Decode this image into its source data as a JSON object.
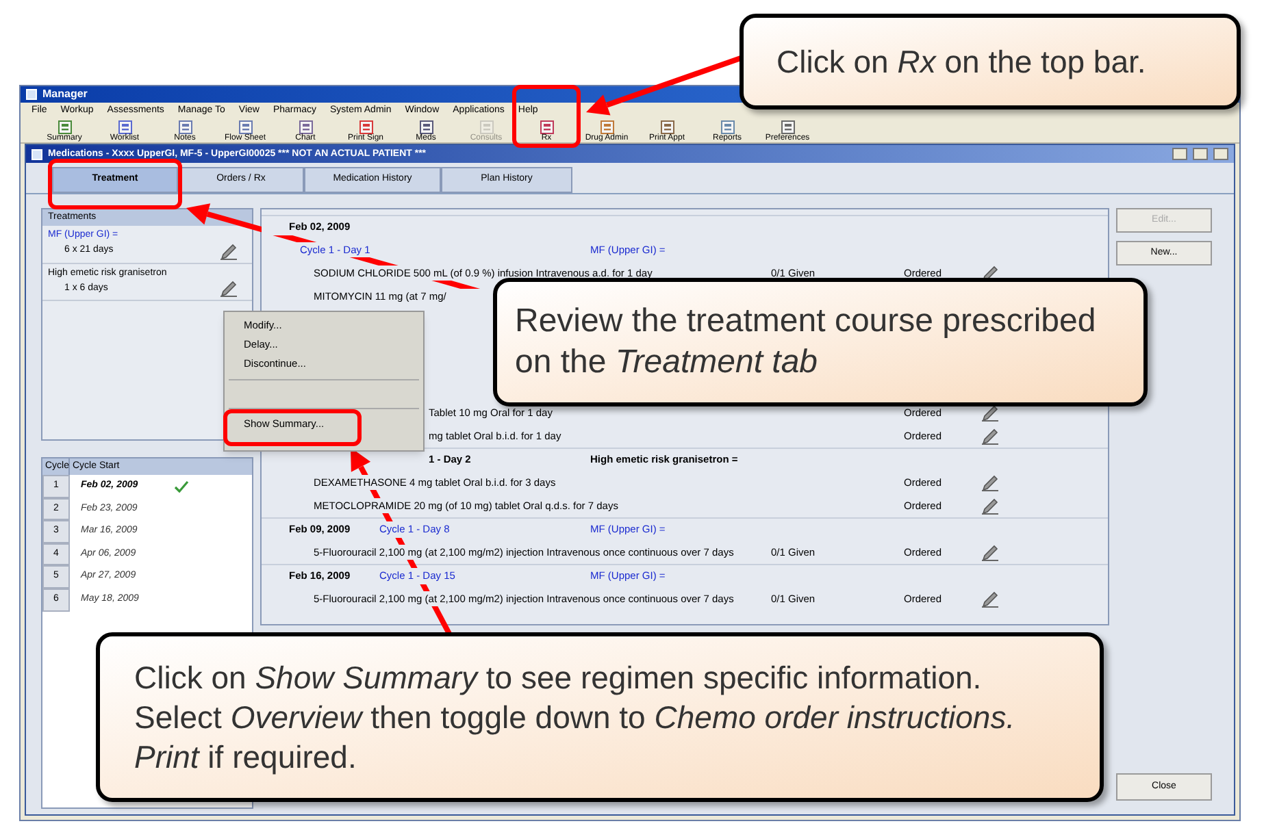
{
  "app_window": {
    "title": "Manager"
  },
  "menu": [
    "File",
    "Workup",
    "Assessments",
    "Manage To",
    "View",
    "Pharmacy",
    "System Admin",
    "Window",
    "Applications",
    "Help"
  ],
  "toolbar": [
    {
      "label": "Summary",
      "disabled": false
    },
    {
      "label": "Worklist",
      "disabled": false
    },
    {
      "label": "Notes",
      "disabled": false
    },
    {
      "label": "Flow Sheet",
      "disabled": false
    },
    {
      "label": "Chart",
      "disabled": false
    },
    {
      "label": "Print Sign",
      "disabled": false
    },
    {
      "label": "Meds",
      "disabled": false
    },
    {
      "label": "Consults",
      "disabled": true
    },
    {
      "label": "Rx",
      "disabled": false
    },
    {
      "label": "Drug Admin",
      "disabled": false
    },
    {
      "label": "Print Appt",
      "disabled": false
    },
    {
      "label": "Reports",
      "disabled": false
    },
    {
      "label": "Preferences",
      "disabled": false
    }
  ],
  "med_window": {
    "title": "Medications - Xxxx UpperGI, MF-5 - UpperGI00025 *** NOT AN ACTUAL PATIENT ***",
    "tabs": [
      {
        "label": "Treatment",
        "selected": true
      },
      {
        "label": "Orders / Rx",
        "selected": false
      },
      {
        "label": "Medication History",
        "selected": false
      },
      {
        "label": "Plan History",
        "selected": false
      }
    ]
  },
  "treatments": {
    "header": "Treatments",
    "items": [
      {
        "name": "MF (Upper GI) =",
        "duration": "6 x 21 days"
      },
      {
        "name": "High emetic risk granisetron",
        "duration": "1 x 6 days"
      }
    ]
  },
  "cycles": {
    "columns": [
      "Cycle",
      "Cycle Start"
    ],
    "rows": [
      {
        "cycle": "1",
        "start": "Feb 02, 2009",
        "current": true
      },
      {
        "cycle": "2",
        "start": "Feb 23, 2009",
        "current": false
      },
      {
        "cycle": "3",
        "start": "Mar 16, 2009",
        "current": false
      },
      {
        "cycle": "4",
        "start": "Apr 06, 2009",
        "current": false
      },
      {
        "cycle": "5",
        "start": "Apr 27, 2009",
        "current": false
      },
      {
        "cycle": "6",
        "start": "May 18, 2009",
        "current": false
      }
    ]
  },
  "schedule": [
    {
      "kind": "date",
      "date": "Feb 02, 2009"
    },
    {
      "kind": "cycle",
      "cycle": "Cycle 1 - Day 1",
      "regimen": "MF (Upper GI) ="
    },
    {
      "kind": "drug",
      "text": "SODIUM CHLORIDE 500 mL (of 0.9 %) infusion Intravenous a.d. for 1 day",
      "given": "0/1 Given",
      "status": "Ordered"
    },
    {
      "kind": "drug",
      "text": "MITOMYCIN 11 mg (at 7 mg/"
    },
    {
      "kind": "drug-tail",
      "text": "Tablet 10 mg Oral for 1 day",
      "status": "Ordered"
    },
    {
      "kind": "drug-tail",
      "text": "mg tablet Oral b.i.d. for 1 day",
      "status": "Ordered"
    },
    {
      "kind": "cycle-tail",
      "cycle": "1 - Day 2",
      "regimen": "High emetic risk granisetron ="
    },
    {
      "kind": "drug",
      "text": "DEXAMETHASONE 4 mg tablet Oral b.i.d. for 3 days",
      "status": "Ordered"
    },
    {
      "kind": "drug",
      "text": "METOCLOPRAMIDE 20 mg (of 10 mg) tablet Oral q.d.s. for 7 days",
      "status": "Ordered"
    },
    {
      "kind": "date",
      "date": "Feb 09, 2009",
      "cycle": "Cycle 1 - Day 8",
      "regimen": "MF (Upper GI) ="
    },
    {
      "kind": "drug",
      "text": "5-Fluorouracil 2,100 mg (at 2,100 mg/m2) injection Intravenous once continuous over 7 days",
      "given": "0/1 Given",
      "status": "Ordered"
    },
    {
      "kind": "date",
      "date": "Feb 16, 2009",
      "cycle": "Cycle 1 - Day 15",
      "regimen": "MF (Upper GI) ="
    },
    {
      "kind": "drug",
      "text": "5-Fluorouracil 2,100 mg (at 2,100 mg/m2) injection Intravenous once continuous over 7 days",
      "given": "0/1 Given",
      "status": "Ordered"
    }
  ],
  "context_menu": [
    [
      "Modify...",
      "Delay...",
      "Discontinue..."
    ],
    [
      "Show Summary..."
    ]
  ],
  "side_buttons": [
    {
      "label": "Edit...",
      "disabled": true
    },
    {
      "label": "New...",
      "disabled": false
    }
  ],
  "close_button": "Close",
  "callouts": [
    "Click on *Rx* on the top bar.",
    "Review the treatment course prescribed on the *Treatment tab*",
    "Click on *Show Summary* to see regimen specific information. Select *Overview* then toggle down to *Chemo order instructions. Print* if required."
  ]
}
